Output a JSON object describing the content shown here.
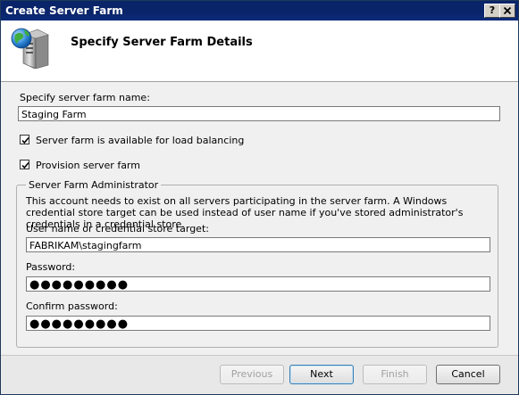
{
  "window": {
    "title": "Create Server Farm",
    "help_label": "?",
    "close_label": "X"
  },
  "header": {
    "title": "Specify Server Farm Details",
    "icon": "server-globe-icon"
  },
  "form": {
    "farm_name_label": "Specify server farm name:",
    "farm_name_value": "Staging Farm",
    "load_balancing_label": "Server farm is available for load balancing",
    "load_balancing_checked": true,
    "provision_label": "Provision server farm",
    "provision_checked": true
  },
  "admin": {
    "group_label": "Server Farm Administrator",
    "description": "This account needs to exist on all servers participating in the server farm. A Windows credential store target can be used instead of user name if you've stored administrator's credentials in a credential store.",
    "user_label": "User name or credential store target:",
    "user_value": "FABRIKAM\\stagingfarm",
    "password_label": "Password:",
    "password_value": "●●●●●●●●●",
    "confirm_label": "Confirm password:",
    "confirm_value": "●●●●●●●●●"
  },
  "buttons": {
    "previous": "Previous",
    "next": "Next",
    "finish": "Finish",
    "cancel": "Cancel"
  }
}
